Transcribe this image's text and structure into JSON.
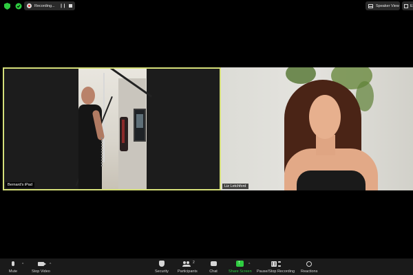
{
  "top_bar": {
    "recording_label": "Recording...",
    "pause_glyph": "❙❙",
    "speaker_view_label": "Speaker View",
    "exit_label": "Ex"
  },
  "participants": [
    {
      "name": "Bernard's iPad",
      "active_speaker": true
    },
    {
      "name": "Liz Letchford",
      "active_speaker": false
    }
  ],
  "toolbar": {
    "mute_label": "Mute",
    "stop_video_label": "Stop Video",
    "security_label": "Security",
    "participants_label": "Participants",
    "participants_count": "2",
    "chat_label": "Chat",
    "share_screen_label": "Share Screen",
    "pause_stop_label": "Pause/Stop Recording",
    "reactions_label": "Reactions",
    "caret_glyph": "^"
  },
  "colors": {
    "active_speaker_border": "#d6e07a",
    "share_screen": "#2ecc40",
    "toolbar_bg": "#1a1a1a"
  },
  "icons": [
    "shield-icon",
    "lock-icon",
    "record-icon",
    "pause-icon",
    "stop-icon",
    "grid-icon",
    "exit-fullscreen-icon",
    "microphone-icon",
    "video-camera-icon",
    "security-icon",
    "participants-icon",
    "chat-icon",
    "share-screen-icon",
    "reactions-icon"
  ]
}
